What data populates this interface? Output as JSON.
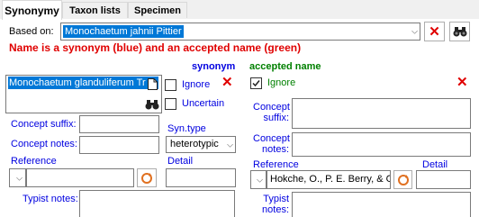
{
  "tabs": [
    "Synonymy",
    "Taxon lists",
    "Specimen"
  ],
  "based_on": {
    "label": "Based on:",
    "value": "Monochaetum jahnii Pittier"
  },
  "info_message": "Name is a synonym (blue) and an accepted name (green)",
  "headers": {
    "synonym": "synonym",
    "accepted": "accepted name"
  },
  "synonym": {
    "name": "Monochaetum glanduliferum Tr",
    "ignore_label": "Ignore",
    "uncertain_label": "Uncertain",
    "concept_suffix_label": "Concept suffix:",
    "concept_notes_label": "Concept notes:",
    "syn_type_label": "Syn.type",
    "syn_type_value": "heterotypic",
    "reference_label": "Reference",
    "detail_label": "Detail",
    "typist_notes_label": "Typist notes:"
  },
  "accepted": {
    "ignore_label": "Ignore",
    "concept_suffix_label_1": "Concept",
    "concept_suffix_label_2": "suffix:",
    "concept_notes_label_1": "Concept",
    "concept_notes_label_2": "notes:",
    "reference_label": "Reference",
    "reference_value": "Hokche, O., P. E. Berry, & O",
    "detail_label": "Detail",
    "typist_notes_label_1": "Typist",
    "typist_notes_label_2": "notes:"
  },
  "colors": {
    "blue_label": "#0000e0",
    "green_label": "#008000",
    "red_message": "#e00000",
    "selection": "#0078d7"
  }
}
